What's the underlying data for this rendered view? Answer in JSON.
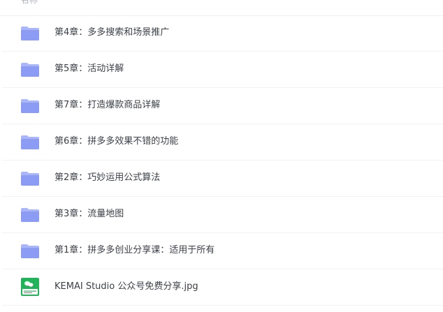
{
  "header": {
    "name_column": "名称"
  },
  "items": [
    {
      "name": "第4章：多多搜索和场景推广",
      "type": "folder"
    },
    {
      "name": "第5章：活动详解",
      "type": "folder"
    },
    {
      "name": "第7章：打造爆款商品详解",
      "type": "folder"
    },
    {
      "name": "第6章：拼多多效果不错的功能",
      "type": "folder"
    },
    {
      "name": "第2章：巧妙运用公式算法",
      "type": "folder"
    },
    {
      "name": "第3章：流量地图",
      "type": "folder"
    },
    {
      "name": "第1章：拼多多创业分享课：适用于所有",
      "type": "folder"
    },
    {
      "name": "KEMAI Studio 公众号免费分享.jpg",
      "type": "image"
    }
  ],
  "colors": {
    "folder_front": "#8c9cf5",
    "folder_back": "#a9b6fb",
    "image_green": "#22b35a"
  }
}
